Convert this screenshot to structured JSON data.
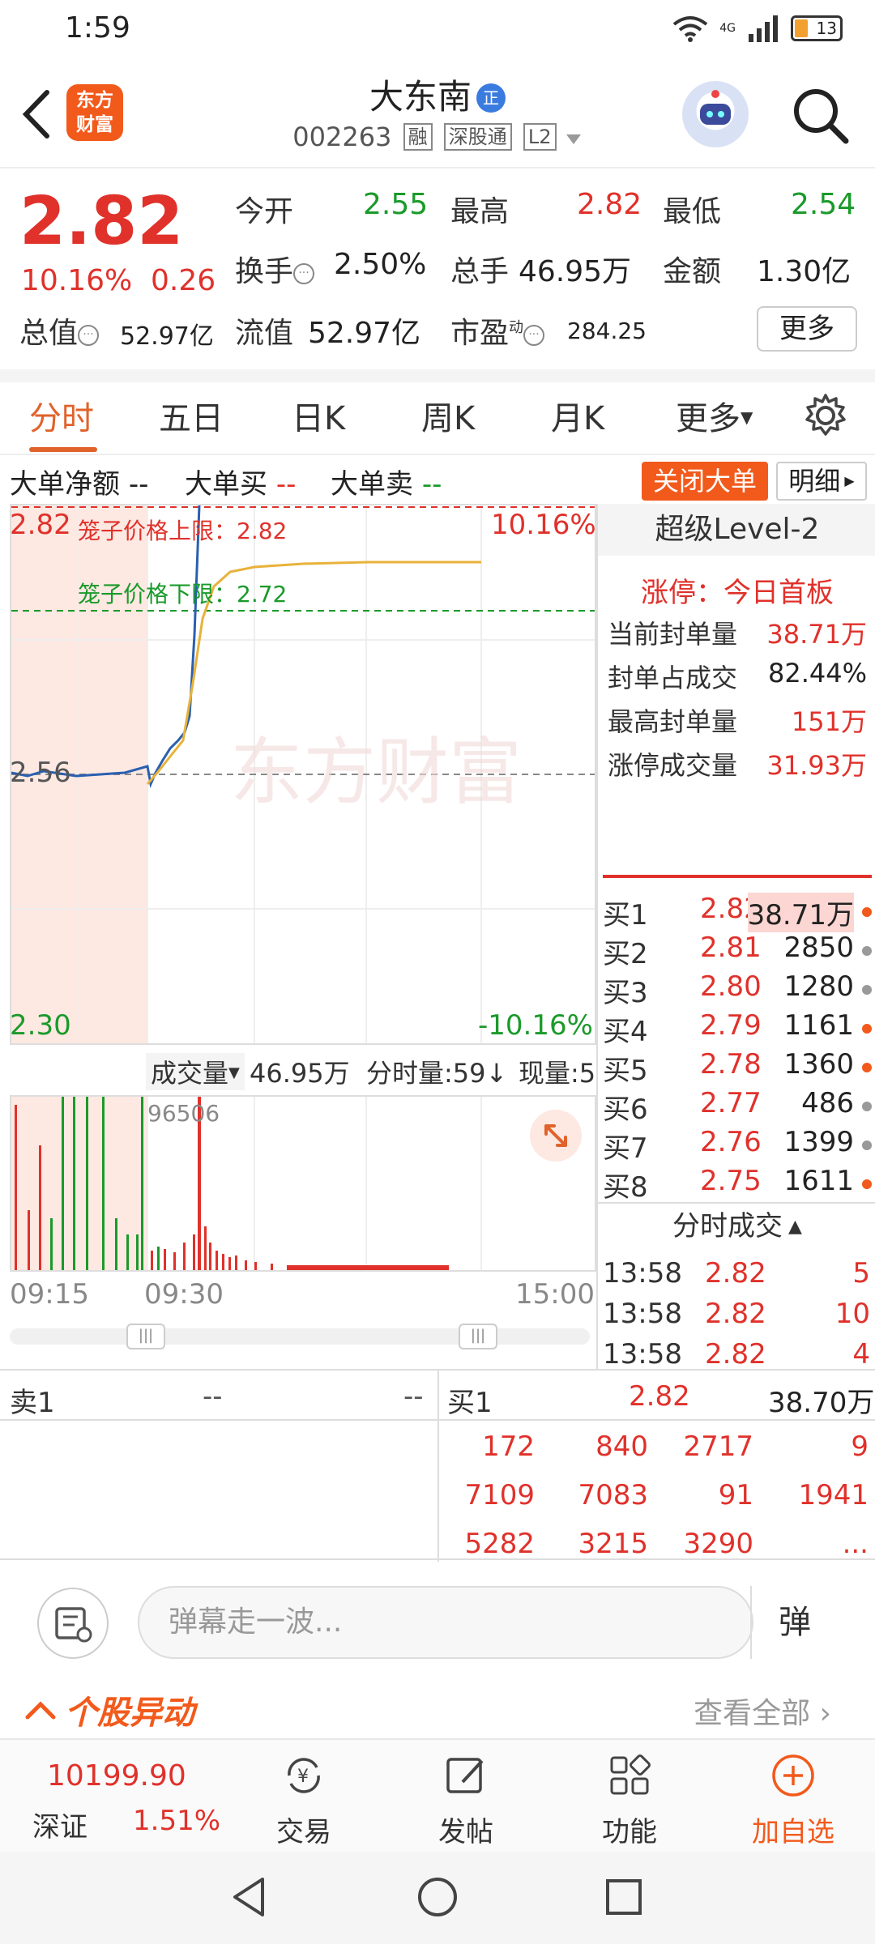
{
  "status": {
    "time": "1:59",
    "battery": "13",
    "network": "4G"
  },
  "header": {
    "logo_line1": "东方",
    "logo_line2": "财富",
    "stock_name": "大东南",
    "name_badge": "正",
    "stock_code": "002263",
    "tags": [
      "融",
      "深股通",
      "L2"
    ]
  },
  "quote": {
    "price": "2.82",
    "change_pct": "10.16%",
    "change": "0.26",
    "open_label": "今开",
    "open": "2.55",
    "high_label": "最高",
    "high": "2.82",
    "low_label": "最低",
    "low": "2.54",
    "turnover_label": "换手",
    "turnover": "2.50%",
    "volume_label": "总手",
    "volume": "46.95万",
    "amount_label": "金额",
    "amount": "1.30亿",
    "mktcap_label": "总值",
    "mktcap": "52.97亿",
    "float_label": "流值",
    "float_cap": "52.97亿",
    "pe_label": "市盈",
    "pe_sup": "动",
    "pe": "284.25",
    "more_label": "更多"
  },
  "tabs": [
    "分时",
    "五日",
    "日K",
    "周K",
    "月K",
    "更多"
  ],
  "large_orders": {
    "net_label": "大单净额",
    "net_value": "--",
    "buy_label": "大单买",
    "buy_value": "--",
    "sell_label": "大单卖",
    "sell_value": "--",
    "close_label": "关闭大单",
    "detail_label": "明细"
  },
  "chart": {
    "upper_price": "2.82",
    "upper_pct": "10.16%",
    "lower_price": "2.30",
    "lower_pct": "-10.16%",
    "ref_price": "2.56",
    "cage_upper": "笼子价格上限：2.82",
    "cage_lower": "笼子价格下限：2.72",
    "watermark": "东方财富",
    "volume_label": "成交量",
    "volume_total": "46.95万",
    "minute_vol": "分时量:59↓",
    "current_vol": "现量:5",
    "vol_peak": "96506",
    "time_start": "09:15",
    "time_open": "09:30",
    "time_end": "15:00"
  },
  "level2": {
    "title": "超级Level-2",
    "limit_up_status": "涨停：今日首板",
    "stats": [
      {
        "label": "当前封单量",
        "value": "38.71万"
      },
      {
        "label": "封单占成交",
        "value": "82.44%"
      },
      {
        "label": "最高封单量",
        "value": "151万"
      },
      {
        "label": "涨停成交量",
        "value": "31.93万"
      }
    ],
    "bids": [
      {
        "label": "买1",
        "price": "2.82",
        "qty": "38.71万",
        "dot": "#f25a1c"
      },
      {
        "label": "买2",
        "price": "2.81",
        "qty": "2850",
        "dot": "#999999"
      },
      {
        "label": "买3",
        "price": "2.80",
        "qty": "1280",
        "dot": "#999999"
      },
      {
        "label": "买4",
        "price": "2.79",
        "qty": "1161",
        "dot": "#f25a1c"
      },
      {
        "label": "买5",
        "price": "2.78",
        "qty": "1360",
        "dot": "#f25a1c"
      },
      {
        "label": "买6",
        "price": "2.77",
        "qty": "486",
        "dot": "#999999"
      },
      {
        "label": "买7",
        "price": "2.76",
        "qty": "1399",
        "dot": "#999999"
      },
      {
        "label": "买8",
        "price": "2.75",
        "qty": "1611",
        "dot": "#f25a1c"
      }
    ],
    "ts_title": "分时成交",
    "trades": [
      {
        "time": "13:58",
        "price": "2.82",
        "qty": "5"
      },
      {
        "time": "13:58",
        "price": "2.82",
        "qty": "10"
      },
      {
        "time": "13:58",
        "price": "2.82",
        "qty": "4"
      }
    ]
  },
  "queue": {
    "sell_label": "卖1",
    "sell_price": "--",
    "sell_qty": "--",
    "buy_label": "买1",
    "buy_price": "2.82",
    "buy_qty": "38.70万",
    "cells": [
      [
        "172",
        "840",
        "2717",
        "9"
      ],
      [
        "7109",
        "7083",
        "91",
        "1941"
      ],
      [
        "5282",
        "3215",
        "3290",
        "..."
      ]
    ]
  },
  "danmu": {
    "placeholder": "弹幕走一波...",
    "send": "弹"
  },
  "anomaly": {
    "title": "个股异动",
    "view_all": "查看全部"
  },
  "bottom_nav": {
    "index_value": "10199.90",
    "index_name": "深证",
    "index_pct": "1.51%",
    "items": [
      "交易",
      "发帖",
      "功能",
      "加自选"
    ]
  },
  "colors": {
    "up": "#e0312b",
    "down": "#1a9a2a",
    "accent": "#f25a1c"
  }
}
